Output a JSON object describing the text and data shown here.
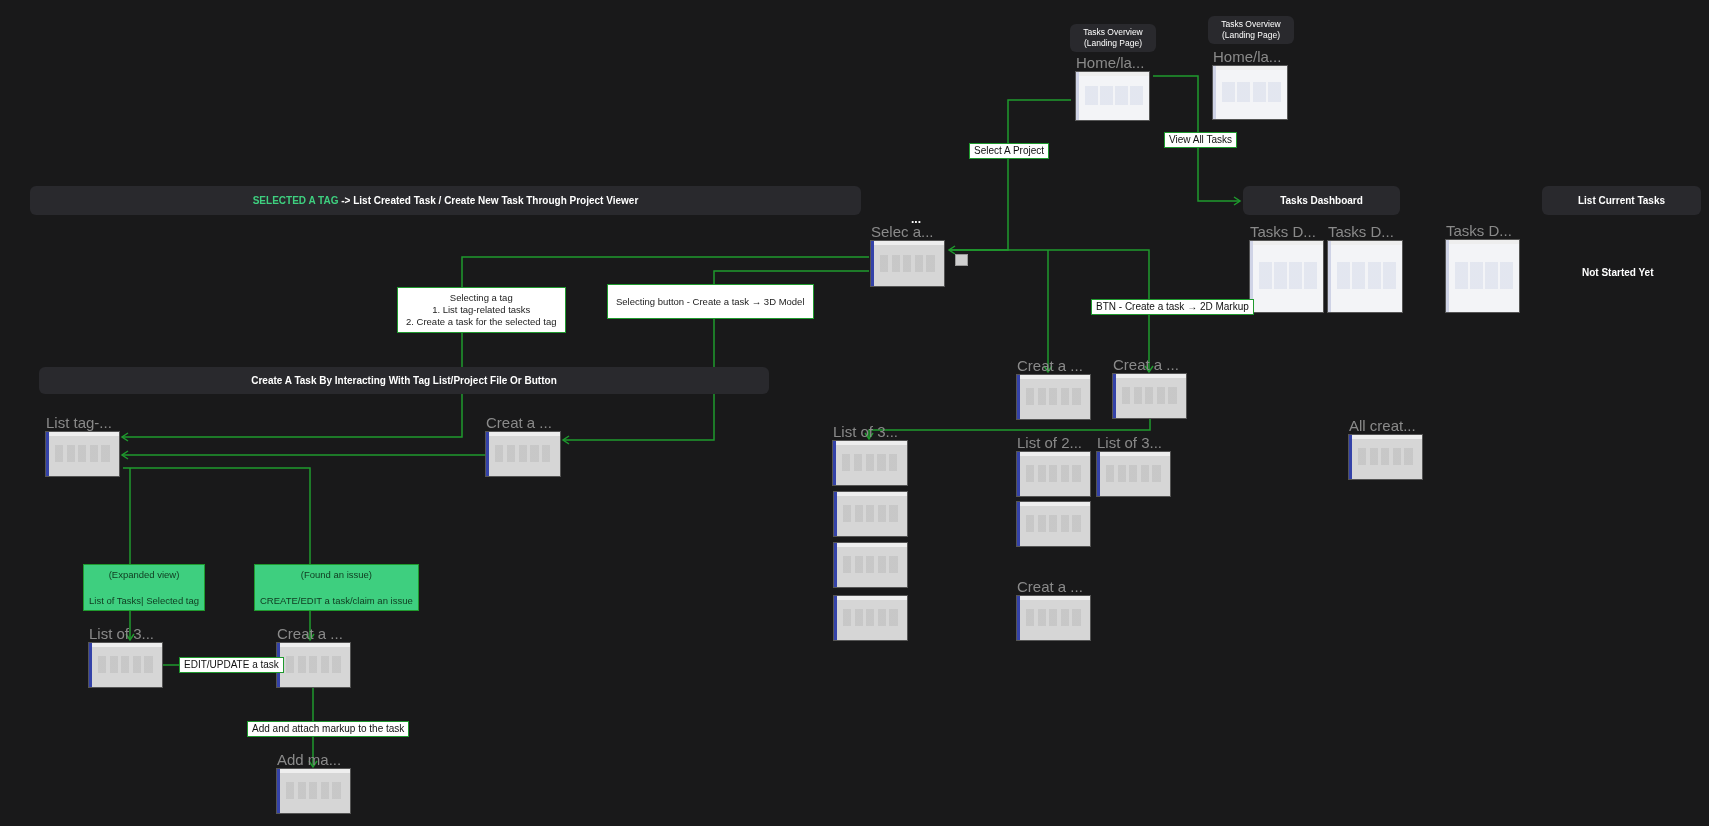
{
  "sections": [
    {
      "highlight": "SELECTED A TAG",
      "title": "-> List Created Task / Create New Task Through Project Viewer"
    },
    {
      "title": "Create A Task By Interacting With Tag List/Project File Or Button"
    },
    {
      "title": "Tasks Overview (Landing Page)"
    },
    {
      "title": "Tasks Overview (Landing Page)"
    },
    {
      "title": "Tasks Dashboard"
    },
    {
      "title": "List Current Tasks"
    }
  ],
  "status_note": "Not Started Yet",
  "frames": [
    {
      "label": "Home/la...",
      "kind": "dashboard"
    },
    {
      "label": "Home/la...",
      "kind": "dashboard"
    },
    {
      "label": "Selec a...",
      "kind": "wireframe",
      "overflow_text": "..."
    },
    {
      "label": "Tasks D...",
      "kind": "dashboard"
    },
    {
      "label": "Tasks D...",
      "kind": "dashboard"
    },
    {
      "label": "Tasks D...",
      "kind": "dashboard"
    },
    {
      "label": "List tag-...",
      "kind": "wireframe"
    },
    {
      "label": "Creat a ...",
      "kind": "wireframe"
    },
    {
      "label": "Creat a ...",
      "kind": "wireframe"
    },
    {
      "label": "Creat a ...",
      "kind": "wireframe"
    },
    {
      "label": "List of 3...",
      "kind": "wireframe"
    },
    {
      "kind": "wireframe"
    },
    {
      "kind": "wireframe"
    },
    {
      "kind": "wireframe"
    },
    {
      "label": "List of 2...",
      "kind": "wireframe"
    },
    {
      "label": "List of 3...",
      "kind": "wireframe"
    },
    {
      "kind": "wireframe"
    },
    {
      "label": "Creat a ...",
      "kind": "wireframe"
    },
    {
      "label": "All creat...",
      "kind": "wireframe"
    },
    {
      "label": "List of 3...",
      "kind": "wireframe"
    },
    {
      "label": "Creat a ...",
      "kind": "wireframe"
    },
    {
      "label": "Add ma...",
      "kind": "wireframe"
    }
  ],
  "notes": [
    {
      "kind": "tag",
      "lines": [
        "Select A Project"
      ]
    },
    {
      "kind": "tag",
      "lines": [
        "View All Tasks"
      ]
    },
    {
      "kind": "card",
      "lines": [
        "Selecting a tag",
        "1. List tag-related tasks",
        "2. Create a task for the selected tag"
      ]
    },
    {
      "kind": "card",
      "lines": [
        "Selecting button - Create a task → 3D Model"
      ]
    },
    {
      "kind": "tag",
      "lines": [
        "BTN - Create a task → 2D Markup"
      ]
    },
    {
      "kind": "filled",
      "lines": [
        "(Expanded view)",
        "List of Tasks| Selected tag"
      ]
    },
    {
      "kind": "filled",
      "lines": [
        "(Found an issue)",
        "CREATE/EDIT a task/claim an issue"
      ]
    },
    {
      "kind": "tag",
      "lines": [
        "EDIT/UPDATE a task"
      ]
    },
    {
      "kind": "tag",
      "lines": [
        "Add and attach markup to the task"
      ]
    }
  ]
}
